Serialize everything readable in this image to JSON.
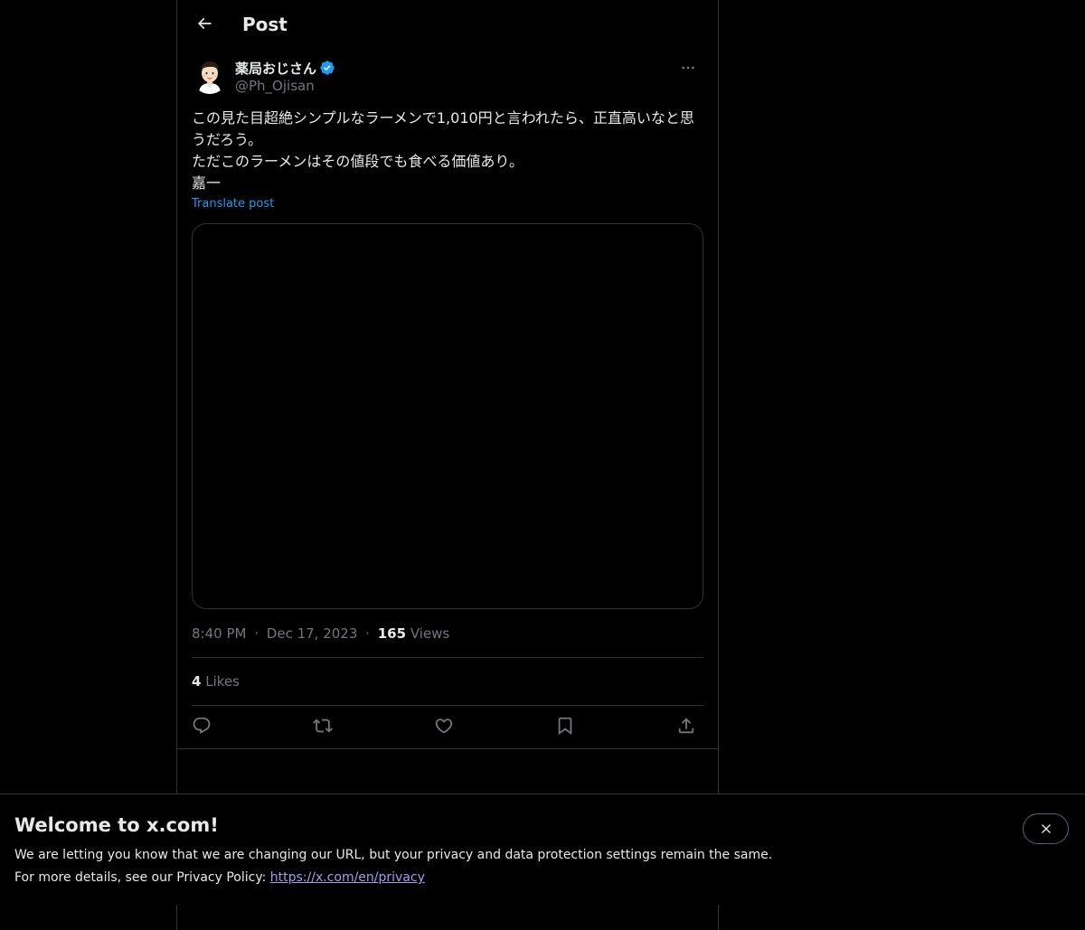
{
  "header": {
    "title": "Post"
  },
  "author": {
    "display_name": "薬局おじさん",
    "handle": "@Ph_Ojisan",
    "verified": true
  },
  "post": {
    "text": "この見た目超絶シンプルなラーメンで1,010円と言われたら、正直高いなと思うだろう。\nただこのラーメンはその値段でも食べる価値あり。\n嘉一",
    "translate_label": "Translate post",
    "time": "8:40 PM",
    "separator": "·",
    "date": "Dec 17, 2023",
    "views_count": "165",
    "views_label": "Views",
    "likes_count": "4",
    "likes_label": "Likes"
  },
  "actions": [
    {
      "name": "reply",
      "icon": "reply-icon"
    },
    {
      "name": "repost",
      "icon": "repost-icon"
    },
    {
      "name": "like",
      "icon": "heart-icon"
    },
    {
      "name": "bookmark",
      "icon": "bookmark-icon"
    },
    {
      "name": "share",
      "icon": "share-icon"
    }
  ],
  "banner": {
    "title": "Welcome to x.com!",
    "line1": "We are letting you know that we are changing our URL, but your privacy and data protection settings remain the same.",
    "line2_prefix": "For more details, see our Privacy Policy: ",
    "privacy_link": "https://x.com/en/privacy"
  },
  "colors": {
    "background": "#000000",
    "text": "#e7e9ea",
    "secondary_text": "#71767b",
    "accent": "#1d9bf0",
    "border": "#2f3336",
    "link_visited": "#a59bf0"
  }
}
